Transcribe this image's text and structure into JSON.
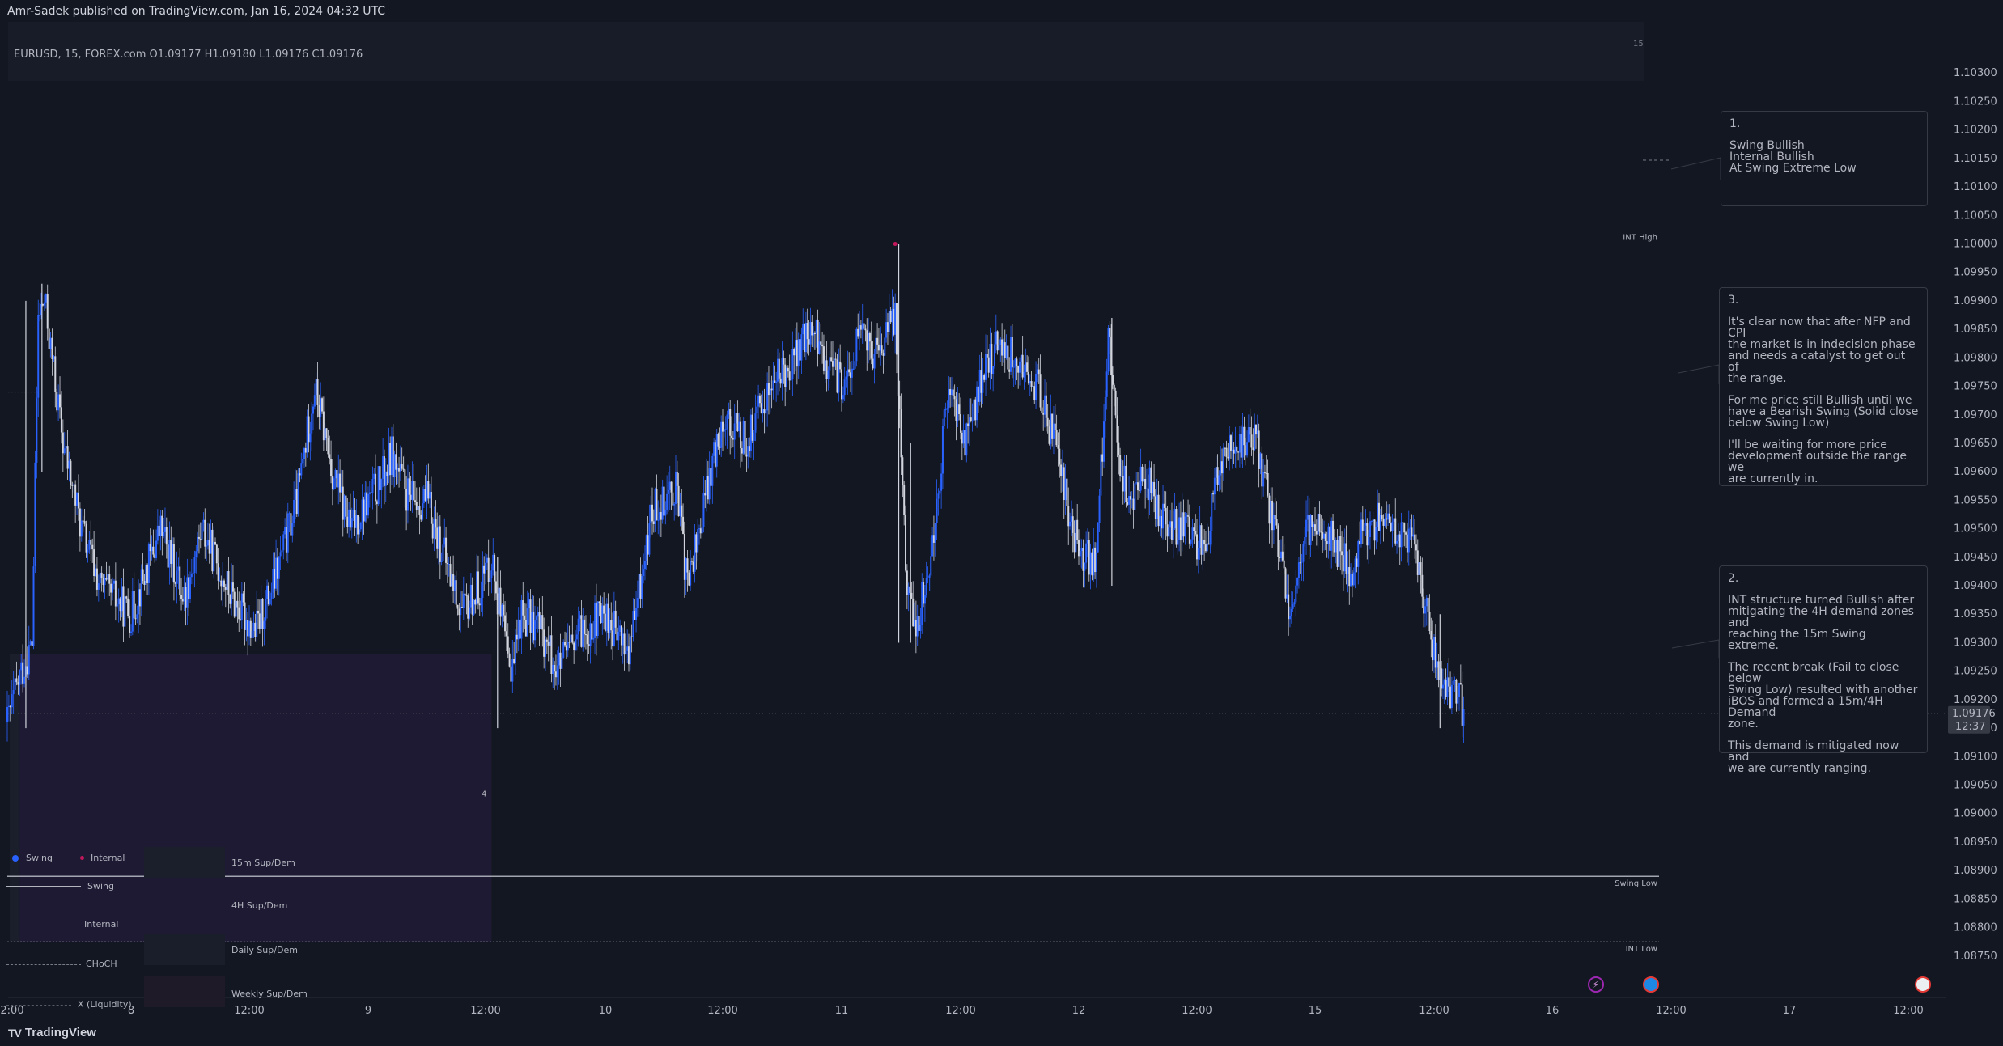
{
  "header": {
    "published": "Amr-Sadek published on TradingView.com, Jan 16, 2024 04:32 UTC",
    "symbol_line": "EURUSD, 15, FOREX.com  O1.09177  H1.09180  L1.09176  C1.09176",
    "corner_label": "15"
  },
  "footer": {
    "brand": "TradingView"
  },
  "chart_data": {
    "type": "candlestick",
    "symbol": "EURUSD",
    "interval": "15",
    "exchange": "FOREX.com",
    "ohlc": {
      "open": 1.09177,
      "high": 1.0918,
      "low": 1.09176,
      "close": 1.09176
    },
    "last_price": "1.09176",
    "countdown": "12:37",
    "ylim": [
      1.087,
      1.1035
    ],
    "y_ticks": [
      "1.10300",
      "1.10250",
      "1.10200",
      "1.10150",
      "1.10100",
      "1.10050",
      "1.10000",
      "1.09950",
      "1.09900",
      "1.09850",
      "1.09800",
      "1.09750",
      "1.09700",
      "1.09650",
      "1.09600",
      "1.09550",
      "1.09500",
      "1.09450",
      "1.09400",
      "1.09350",
      "1.09300",
      "1.09250",
      "1.09200",
      "1.09150",
      "1.09100",
      "1.09050",
      "1.09000",
      "1.08950",
      "1.08900",
      "1.08850",
      "1.08800",
      "1.08750"
    ],
    "x_ticks": [
      "2:00",
      "8",
      "12:00",
      "9",
      "12:00",
      "10",
      "12:00",
      "11",
      "12:00",
      "12",
      "12:00",
      "15",
      "12:00",
      "16",
      "12:00",
      "17",
      "12:00"
    ],
    "price_path": [
      {
        "t": 0,
        "p": 1.0916
      },
      {
        "t": 0.1,
        "p": 1.0924
      },
      {
        "t": 0.2,
        "p": 1.093
      },
      {
        "t": 0.25,
        "p": 1.0987
      },
      {
        "t": 0.3,
        "p": 1.099
      },
      {
        "t": 0.45,
        "p": 1.0965
      },
      {
        "t": 0.6,
        "p": 1.095
      },
      {
        "t": 0.75,
        "p": 1.094
      },
      {
        "t": 1.0,
        "p": 1.0935
      },
      {
        "t": 1.25,
        "p": 1.095
      },
      {
        "t": 1.45,
        "p": 1.0938
      },
      {
        "t": 1.6,
        "p": 1.095
      },
      {
        "t": 1.85,
        "p": 1.0938
      },
      {
        "t": 2.05,
        "p": 1.0932
      },
      {
        "t": 2.2,
        "p": 1.094
      },
      {
        "t": 2.4,
        "p": 1.0955
      },
      {
        "t": 2.55,
        "p": 1.0975
      },
      {
        "t": 2.7,
        "p": 1.096
      },
      {
        "t": 2.85,
        "p": 1.095
      },
      {
        "t": 3.0,
        "p": 1.0955
      },
      {
        "t": 3.1,
        "p": 1.0958
      },
      {
        "t": 3.2,
        "p": 1.0963
      },
      {
        "t": 3.35,
        "p": 1.0955
      },
      {
        "t": 3.5,
        "p": 1.0955
      },
      {
        "t": 3.65,
        "p": 1.0945
      },
      {
        "t": 3.8,
        "p": 1.0935
      },
      {
        "t": 3.95,
        "p": 1.094
      },
      {
        "t": 4.05,
        "p": 1.0945
      },
      {
        "t": 4.2,
        "p": 1.0925
      },
      {
        "t": 4.3,
        "p": 1.0935
      },
      {
        "t": 4.45,
        "p": 1.0933
      },
      {
        "t": 4.6,
        "p": 1.0925
      },
      {
        "t": 4.8,
        "p": 1.0932
      },
      {
        "t": 5.0,
        "p": 1.0935
      },
      {
        "t": 5.2,
        "p": 1.0928
      },
      {
        "t": 5.4,
        "p": 1.0953
      },
      {
        "t": 5.6,
        "p": 1.0958
      },
      {
        "t": 5.7,
        "p": 1.094
      },
      {
        "t": 5.85,
        "p": 1.0955
      },
      {
        "t": 6.0,
        "p": 1.097
      },
      {
        "t": 6.2,
        "p": 1.0965
      },
      {
        "t": 6.4,
        "p": 1.0975
      },
      {
        "t": 6.6,
        "p": 1.098
      },
      {
        "t": 6.75,
        "p": 1.0985
      },
      {
        "t": 6.9,
        "p": 1.0978
      },
      {
        "t": 7.05,
        "p": 1.0975
      },
      {
        "t": 7.15,
        "p": 1.0985
      },
      {
        "t": 7.3,
        "p": 1.098
      },
      {
        "t": 7.45,
        "p": 1.0988
      },
      {
        "t": 7.55,
        "p": 1.094
      },
      {
        "t": 7.62,
        "p": 1.0932
      },
      {
        "t": 7.75,
        "p": 1.0945
      },
      {
        "t": 7.9,
        "p": 1.0975
      },
      {
        "t": 8.05,
        "p": 1.0965
      },
      {
        "t": 8.2,
        "p": 1.0978
      },
      {
        "t": 8.35,
        "p": 1.0983
      },
      {
        "t": 8.5,
        "p": 1.0978
      },
      {
        "t": 8.65,
        "p": 1.0975
      },
      {
        "t": 8.8,
        "p": 1.0965
      },
      {
        "t": 8.95,
        "p": 1.095
      },
      {
        "t": 9.05,
        "p": 1.0945
      },
      {
        "t": 9.15,
        "p": 1.0945
      },
      {
        "t": 9.25,
        "p": 1.0985
      },
      {
        "t": 9.35,
        "p": 1.096
      },
      {
        "t": 9.45,
        "p": 1.0955
      },
      {
        "t": 9.55,
        "p": 1.096
      },
      {
        "t": 9.7,
        "p": 1.0952
      },
      {
        "t": 9.85,
        "p": 1.095
      },
      {
        "t": 10.0,
        "p": 1.0948
      },
      {
        "t": 10.1,
        "p": 1.095
      },
      {
        "t": 10.2,
        "p": 1.0962
      },
      {
        "t": 10.35,
        "p": 1.0965
      },
      {
        "t": 10.5,
        "p": 1.0965
      },
      {
        "t": 10.6,
        "p": 1.0955
      },
      {
        "t": 10.7,
        "p": 1.0945
      },
      {
        "t": 10.8,
        "p": 1.0935
      },
      {
        "t": 10.9,
        "p": 1.0948
      },
      {
        "t": 11.0,
        "p": 1.0952
      },
      {
        "t": 11.15,
        "p": 1.0948
      },
      {
        "t": 11.3,
        "p": 1.0942
      },
      {
        "t": 11.4,
        "p": 1.095
      },
      {
        "t": 11.55,
        "p": 1.0952
      },
      {
        "t": 11.7,
        "p": 1.095
      },
      {
        "t": 11.8,
        "p": 1.0948
      },
      {
        "t": 11.9,
        "p": 1.094
      },
      {
        "t": 12.0,
        "p": 1.0928
      },
      {
        "t": 12.1,
        "p": 1.0922
      },
      {
        "t": 12.2,
        "p": 1.092
      },
      {
        "t": 12.26,
        "p": 1.0918
      }
    ],
    "spikes": [
      {
        "t": 0.15,
        "low": 1.0915,
        "high": 1.099
      },
      {
        "t": 0.28,
        "low": 1.096,
        "high": 1.0993
      },
      {
        "t": 4.1,
        "low": 1.0915,
        "high": 1.0945
      },
      {
        "t": 7.48,
        "low": 1.093,
        "high": 1.1
      },
      {
        "t": 7.58,
        "low": 1.093,
        "high": 1.0965
      },
      {
        "t": 9.28,
        "low": 1.094,
        "high": 1.0987
      },
      {
        "t": 12.05,
        "low": 1.0915,
        "high": 1.0935
      }
    ],
    "levels": [
      {
        "name": "INT High",
        "value": 1.1,
        "from_t": 7.45,
        "style": "solid"
      },
      {
        "name": "Swing Low",
        "value": 1.0889,
        "from_t": 0,
        "style": "solid"
      },
      {
        "name": "INT Low",
        "value": 1.08775,
        "from_t": 0,
        "style": "dotted"
      }
    ],
    "zone_4h": {
      "top": 1.0928,
      "bottom": 1.08775,
      "t0": 0.1,
      "t1": 4.05,
      "label": "4"
    },
    "legend": {
      "swing": "Swing",
      "internal": "Internal",
      "swing_line": "Swing",
      "internal_line": "Internal",
      "choch_line": "CHoCH",
      "liquidity_line": "X (Liquidity)",
      "zones": [
        "15m Sup/Dem",
        "4H Sup/Dem",
        "Daily Sup/Dem",
        "Weekly Sup/Dem"
      ]
    }
  },
  "notes": [
    {
      "num": "1.",
      "paras": [
        "Swing Bullish\nInternal Bullish\nAt Swing Extreme Low"
      ]
    },
    {
      "num": "3.",
      "paras": [
        "It's clear now that after NFP and CPI\nthe market is in indecision phase\nand needs a catalyst to get out of\nthe range.",
        "For me price still Bullish until we\nhave a Bearish Swing (Solid close\nbelow Swing Low)",
        "I'll be waiting for more price\ndevelopment outside the range we\nare currently in."
      ]
    },
    {
      "num": "2.",
      "paras": [
        "INT structure turned Bullish after\nmitigating the 4H demand zones and\nreaching the 15m Swing extreme.",
        "The recent break (Fail to close below\nSwing Low) resulted with another\niBOS and formed a 15m/4H Demand\nzone.",
        "This demand is mitigated now and\nwe are currently ranging."
      ]
    }
  ],
  "colors": {
    "background": "#131722",
    "bull_candle": "#2962ff",
    "bear_candle": "#d1d4dc",
    "zone_4h": "#1e1a34",
    "zone_15m": "#1b1f2b",
    "grid_text": "#b2b5be",
    "price_tag": "#363a45"
  }
}
